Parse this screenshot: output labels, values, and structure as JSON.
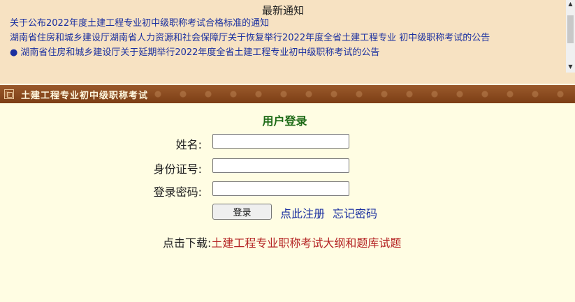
{
  "notice": {
    "title": "最新通知",
    "items": [
      "关于公布2022年度土建工程专业初中级职称考试合格标准的通知",
      "湖南省住房和城乡建设厅湖南省人力资源和社会保障厅关于恢复举行2022年度全省土建工程专业 初中级职称考试的公告",
      "湖南省住房和城乡建设厅关于延期举行2022年度全省土建工程专业初中级职称考试的公告"
    ]
  },
  "header": {
    "title": "土建工程专业初中级职称考试"
  },
  "login": {
    "title": "用户登录",
    "name_label": "姓名:",
    "id_label": "身份证号:",
    "password_label": "登录密码:",
    "name_value": "",
    "id_value": "",
    "password_value": "",
    "submit_label": "登录",
    "register_label": "点此注册",
    "forgot_label": "忘记密码"
  },
  "download": {
    "label": "点击下载:",
    "link_text": "土建工程专业职称考试大纲和题库试题"
  },
  "colors": {
    "notice_bg": "#f7e2c2",
    "header_bar": "#8b4a1e",
    "page_bg": "#fffde3",
    "link_blue": "#1a2fa0",
    "login_title_green": "#1d6a16",
    "download_red": "#b42323"
  }
}
